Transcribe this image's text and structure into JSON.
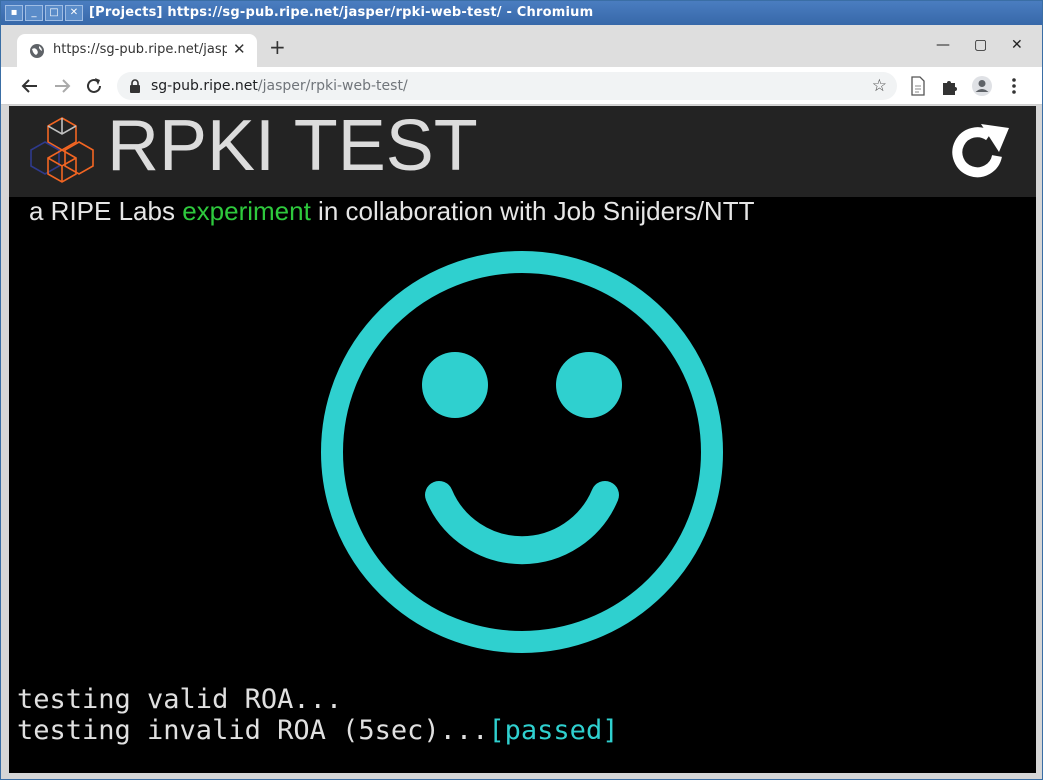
{
  "window": {
    "title": "[Projects] https://sg-pub.ripe.net/jasper/rpki-web-test/ - Chromium",
    "buttons": [
      "⎯",
      "▢",
      "✕"
    ]
  },
  "tab": {
    "title": "https://sg-pub.ripe.net/jasper/rpki-web-test/",
    "close": "✕",
    "new_tab": "+"
  },
  "window_controls": {
    "minimize": "—",
    "maximize": "▢",
    "close": "✕"
  },
  "address_bar": {
    "host": "sg-pub.ripe.net",
    "path": "/jasper/rpki-web-test/"
  },
  "page": {
    "title": "RPKI TEST",
    "subtitle_pre": "a RIPE Labs ",
    "subtitle_link": "experiment",
    "subtitle_post": " in collaboration with Job Snijders/NTT",
    "log": {
      "line1": "testing valid ROA...",
      "line2_prefix": "testing invalid ROA (5sec)...",
      "line2_result": "[passed]"
    }
  },
  "colors": {
    "smiley": "#2fd0cf",
    "accent": "#2ec93d",
    "header_bg": "#232323"
  },
  "icons": [
    "globe-icon",
    "back-icon",
    "forward-icon",
    "reload-icon",
    "lock-icon",
    "star-icon",
    "document-icon",
    "extensions-icon",
    "profile-icon",
    "menu-icon",
    "ripe-logo",
    "refresh-test-icon",
    "smiley-face"
  ]
}
